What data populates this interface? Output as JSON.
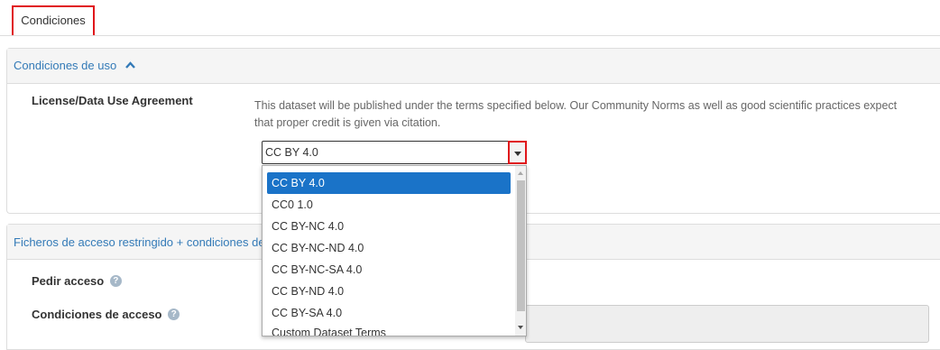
{
  "tabs": {
    "active_label": "Condiciones"
  },
  "terms_panel": {
    "title": "Condiciones de uso",
    "license_label": "License/Data Use Agreement",
    "description": "This dataset will be published under the terms specified below. Our Community Norms as well as good scientific practices expect that proper credit is given via citation.",
    "license_select": {
      "value": "CC BY 4.0",
      "options": [
        "CC BY 4.0",
        "CC0 1.0",
        "CC BY-NC 4.0",
        "CC BY-NC-ND 4.0",
        "CC BY-NC-SA 4.0",
        "CC BY-ND 4.0",
        "CC BY-SA 4.0",
        "Custom Dataset Terms"
      ]
    }
  },
  "restricted_panel": {
    "title": "Ficheros de acceso restringido + condiciones de",
    "request_access_label": "Pedir acceso",
    "access_conditions_label": "Condiciones de acceso"
  },
  "icons": {
    "collapse": "chevron-up-icon",
    "help": "question-circle-icon",
    "dropdown": "caret-down-icon"
  },
  "colors": {
    "link": "#337ab7",
    "highlight": "#e0161b",
    "selected_option": "#1a73c8",
    "panel_heading": "#f5f5f5"
  }
}
